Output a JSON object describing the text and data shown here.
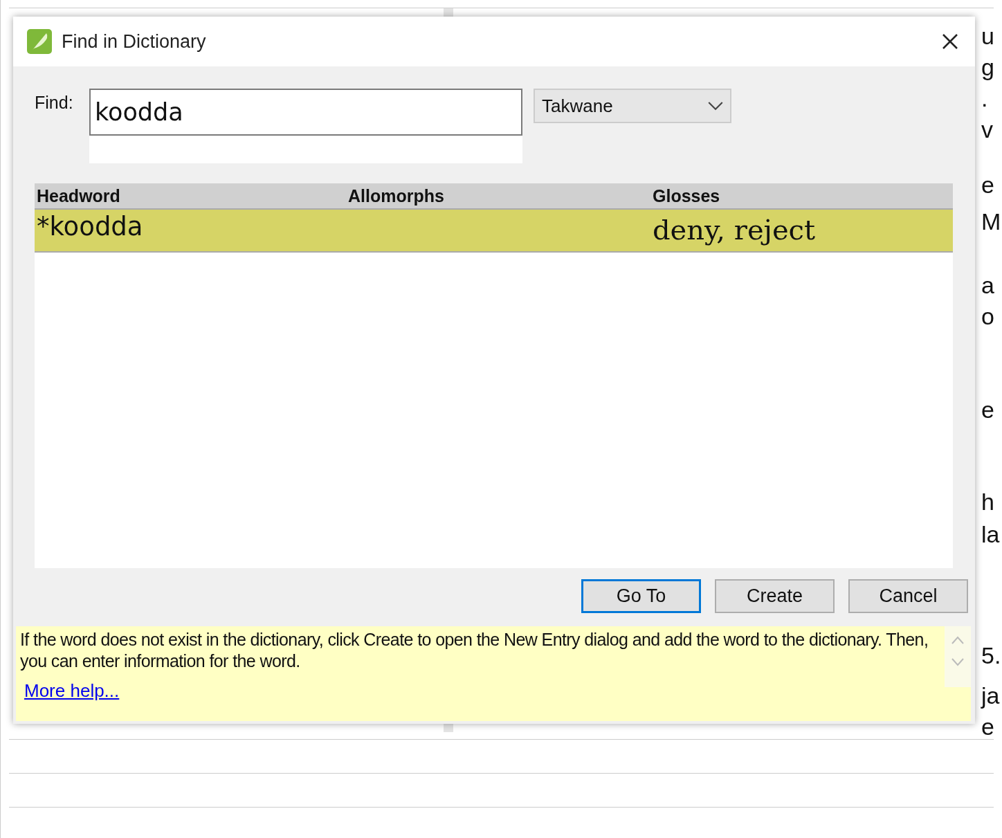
{
  "dialog": {
    "title": "Find in Dictionary",
    "find_label": "Find:",
    "find_value": "koodda",
    "writing_system": "Takwane",
    "table": {
      "columns": [
        "Headword",
        "Allomorphs",
        "Glosses"
      ],
      "rows": [
        {
          "cells": [
            "*koodda",
            "",
            "deny, reject"
          ],
          "selected": true
        }
      ]
    },
    "buttons": [
      {
        "label": "Go To",
        "default": true
      },
      {
        "label": "Create",
        "default": false
      },
      {
        "label": "Cancel",
        "default": false
      }
    ],
    "help": {
      "text": "If the word does not exist in the dictionary, click Create to open the New Entry dialog and add the word to the dictionary. Then, you can enter information for the word.",
      "link": "More help..."
    }
  },
  "background_document": {
    "fragments": [
      "u",
      "g",
      ".",
      "v",
      "e",
      "M",
      "a",
      "o",
      "e",
      "h",
      "la",
      "5.",
      "ja",
      "e"
    ]
  }
}
